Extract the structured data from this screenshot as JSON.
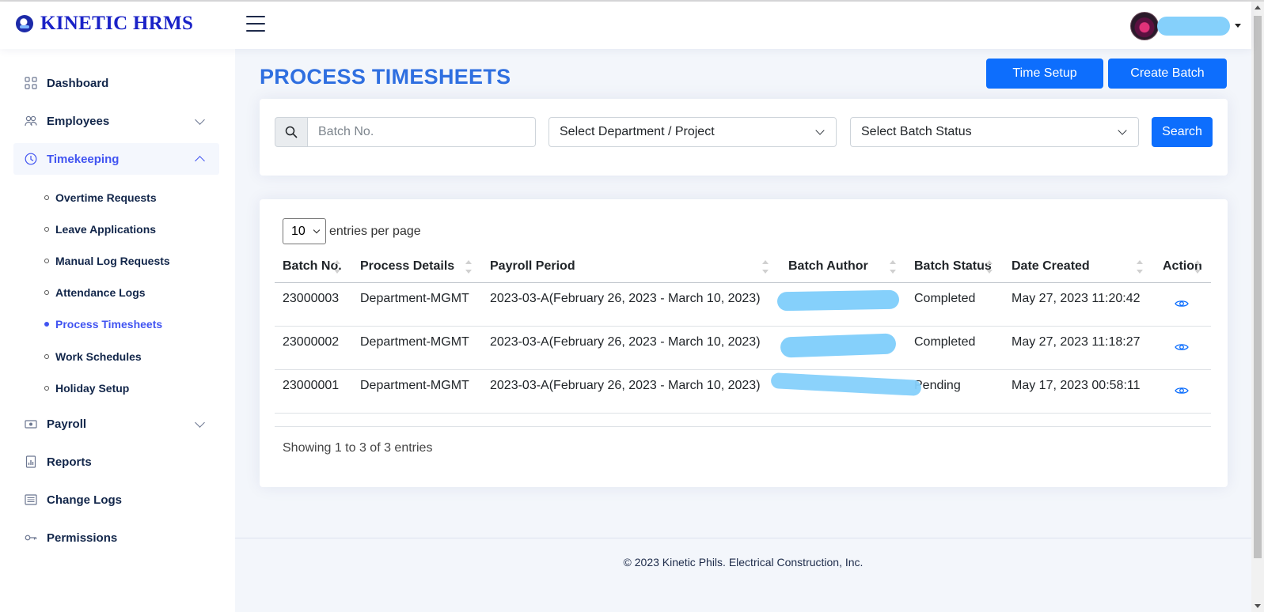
{
  "brand": {
    "name": "KINETIC HRMS"
  },
  "header": {
    "menu_icon": "hamburger-icon",
    "user_avatar": "avatar"
  },
  "sidebar": {
    "items": [
      {
        "label": "Dashboard",
        "icon": "grid-icon"
      },
      {
        "label": "Employees",
        "icon": "users-icon"
      },
      {
        "label": "Timekeeping",
        "icon": "clock-icon"
      },
      {
        "label": "Payroll",
        "icon": "cash-icon"
      },
      {
        "label": "Reports",
        "icon": "report-icon"
      },
      {
        "label": "Change Logs",
        "icon": "list-icon"
      },
      {
        "label": "Permissions",
        "icon": "key-icon"
      }
    ],
    "timekeeping_sub": [
      {
        "label": "Overtime Requests"
      },
      {
        "label": "Leave Applications"
      },
      {
        "label": "Manual Log Requests"
      },
      {
        "label": "Attendance Logs"
      },
      {
        "label": "Process Timesheets"
      },
      {
        "label": "Work Schedules"
      },
      {
        "label": "Holiday Setup"
      }
    ]
  },
  "page": {
    "title": "PROCESS TIMESHEETS",
    "time_setup_label": "Time Setup",
    "create_batch_label": "Create Batch"
  },
  "filters": {
    "batch_placeholder": "Batch No.",
    "department_placeholder": "Select Department / Project",
    "status_placeholder": "Select Batch Status",
    "search_label": "Search"
  },
  "table": {
    "entries_value": "10",
    "entries_label": "entries per page",
    "columns": [
      "Batch No.",
      "Process Details",
      "Payroll Period",
      "Batch Author",
      "Batch Status",
      "Date Created",
      "Action"
    ],
    "rows": [
      {
        "batch_no": "23000003",
        "process": "Department-MGMT",
        "period": "2023-03-A(February 26, 2023 - March 10, 2023)",
        "status": "Completed",
        "date": "May 27, 2023 11:20:42"
      },
      {
        "batch_no": "23000002",
        "process": "Department-MGMT",
        "period": "2023-03-A(February 26, 2023 - March 10, 2023)",
        "status": "Completed",
        "date": "May 27, 2023 11:18:27"
      },
      {
        "batch_no": "23000001",
        "process": "Department-MGMT",
        "period": "2023-03-A(February 26, 2023 - March 10, 2023)",
        "status": "Pending",
        "date": "May 17, 2023 00:58:11"
      }
    ],
    "showing": "Showing 1 to 3 of 3 entries"
  },
  "footer": {
    "text": "© 2023 Kinetic Phils. Electrical Construction, Inc."
  },
  "colors": {
    "primary": "#0d6efd",
    "title": "#2f6fe0",
    "brand": "#1a22c7",
    "active_nav": "#4154f1",
    "redaction": "#85d0fb"
  }
}
